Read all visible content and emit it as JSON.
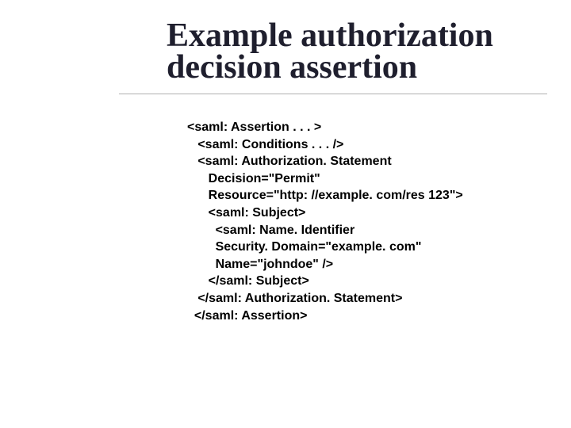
{
  "title_line1": "Example authorization",
  "title_line2": "decision assertion",
  "code": {
    "l01": "<saml: Assertion . . . >",
    "l02": "   <saml: Conditions . . . />",
    "l03": "   <saml: Authorization. Statement",
    "l04": "      Decision=\"Permit\"",
    "l05": "      Resource=\"http: //example. com/res 123\">",
    "l06": "      <saml: Subject>",
    "l07": "        <saml: Name. Identifier",
    "l08": "        Security. Domain=\"example. com\"",
    "l09": "        Name=\"johndoe\" />",
    "l10": "      </saml: Subject>",
    "l11": "   </saml: Authorization. Statement>",
    "l12": "  </saml: Assertion>"
  }
}
